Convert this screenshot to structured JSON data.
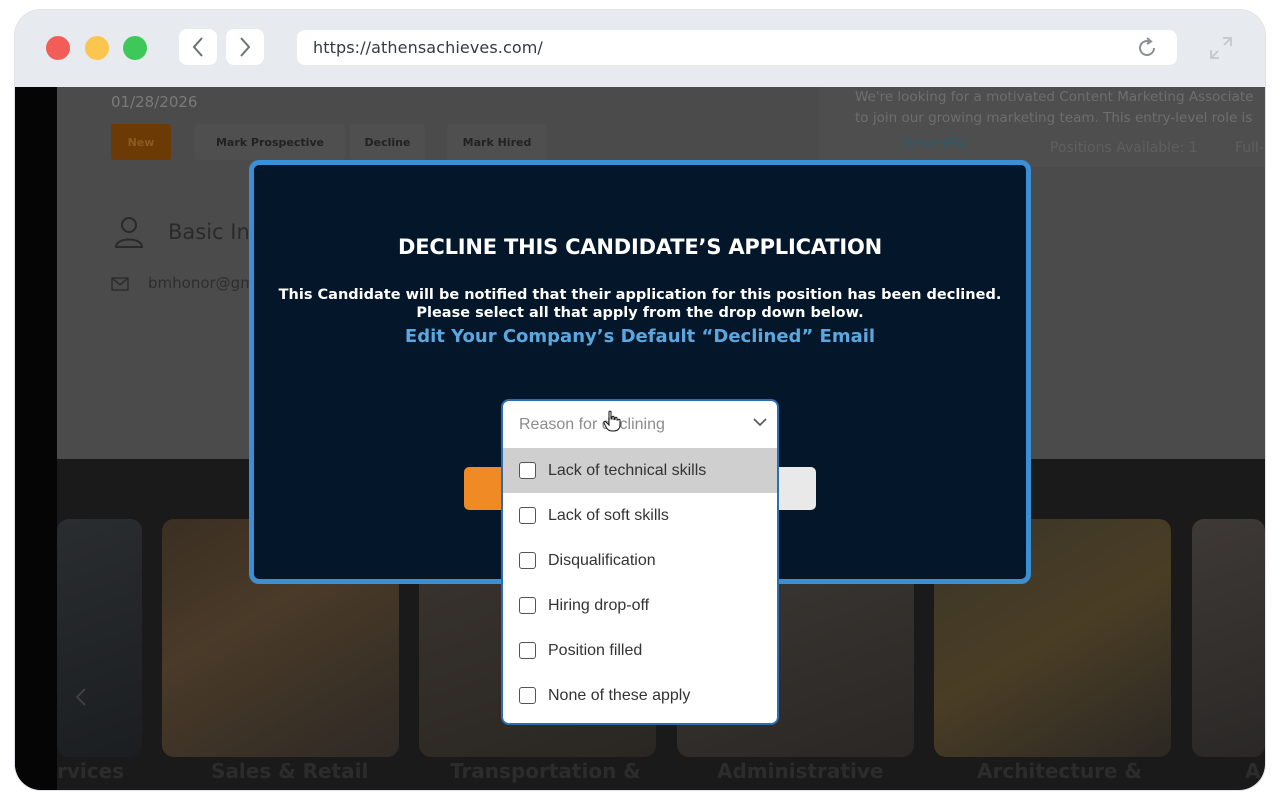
{
  "browser": {
    "url": "https://athensachieves.com/"
  },
  "background_page": {
    "date": "01/28/2026",
    "status_chips": [
      "New",
      "Mark Prospective",
      "Decline",
      "Mark Hired"
    ],
    "section_title": "Basic In",
    "email_partial": "bmhonor@gm",
    "job_description": "We're looking for a motivated Content Marketing Associate to join our growing marketing team. This entry-level role is pe",
    "company_name": "RevenFlo",
    "positions_available": "Positions Available: 1",
    "job_type_partial": "Full-",
    "industries": [
      "rvices",
      "Sales & Retail",
      "Transportation &",
      "Administrative",
      "Architecture &",
      "A"
    ]
  },
  "modal": {
    "title": "DECLINE THIS CANDIDATE’S APPLICATION",
    "message_line1": "This Candidate will be notified that their application for this position has been declined.",
    "message_line2": "Please select all that apply from the drop down below.",
    "edit_link": "Edit Your Company’s Default “Declined” Email"
  },
  "decline_dropdown": {
    "placeholder": "Reason for declining",
    "options": [
      {
        "label": "Lack of technical skills",
        "checked": false,
        "highlighted": true
      },
      {
        "label": "Lack of soft skills",
        "checked": false,
        "highlighted": false
      },
      {
        "label": "Disqualification",
        "checked": false,
        "highlighted": false
      },
      {
        "label": "Hiring drop-off",
        "checked": false,
        "highlighted": false
      },
      {
        "label": "Position filled",
        "checked": false,
        "highlighted": false
      },
      {
        "label": "None of these apply",
        "checked": false,
        "highlighted": false
      }
    ]
  },
  "colors": {
    "modal_bg": "#041629",
    "modal_border": "#3b8fd5",
    "link": "#5ba8e0",
    "primary_button": "#f08a24"
  }
}
